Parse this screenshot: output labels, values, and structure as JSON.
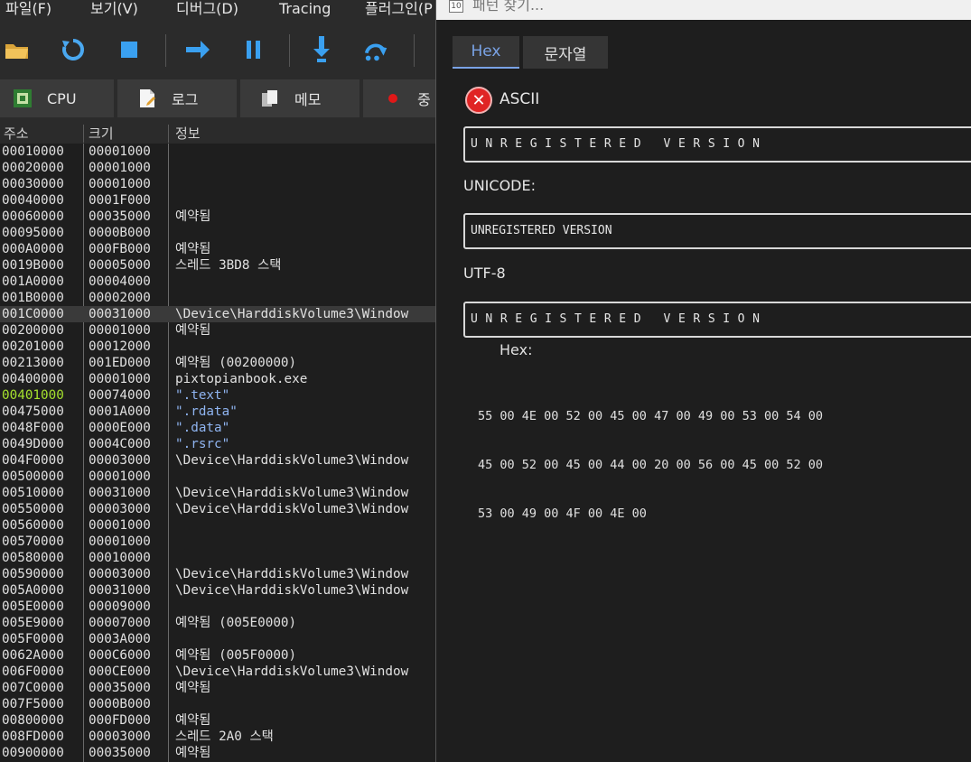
{
  "menubar": {
    "items": [
      "파일(F)",
      "보기(V)",
      "디버그(D)",
      "Tracing",
      "플러그인(P"
    ]
  },
  "toolbar": {
    "icons": [
      "open-folder-icon",
      "restart-icon",
      "stop-icon",
      "run-icon",
      "pause-icon",
      "step-into-icon",
      "step-over-icon"
    ]
  },
  "tabs": [
    {
      "label": "CPU",
      "icon": "cpu-icon"
    },
    {
      "label": "로그",
      "icon": "log-icon"
    },
    {
      "label": "메모",
      "icon": "notes-icon"
    },
    {
      "label": "중",
      "icon": "breakpoint-icon"
    }
  ],
  "memory_map": {
    "headers": [
      "주소",
      "크기",
      "정보"
    ],
    "selected_index": 10,
    "rows": [
      {
        "addr": "00010000",
        "size": "00001000",
        "info": ""
      },
      {
        "addr": "00020000",
        "size": "00001000",
        "info": ""
      },
      {
        "addr": "00030000",
        "size": "00001000",
        "info": ""
      },
      {
        "addr": "00040000",
        "size": "0001F000",
        "info": ""
      },
      {
        "addr": "00060000",
        "size": "00035000",
        "info": "예약됨"
      },
      {
        "addr": "00095000",
        "size": "0000B000",
        "info": ""
      },
      {
        "addr": "000A0000",
        "size": "000FB000",
        "info": "예약됨"
      },
      {
        "addr": "0019B000",
        "size": "00005000",
        "info": "스레드 3BD8 스택"
      },
      {
        "addr": "001A0000",
        "size": "00004000",
        "info": ""
      },
      {
        "addr": "001B0000",
        "size": "00002000",
        "info": ""
      },
      {
        "addr": "001C0000",
        "size": "00031000",
        "info": "\\Device\\HarddiskVolume3\\Window"
      },
      {
        "addr": "00200000",
        "size": "00001000",
        "info": "예약됨"
      },
      {
        "addr": "00201000",
        "size": "00012000",
        "info": ""
      },
      {
        "addr": "00213000",
        "size": "001ED000",
        "info": "예약됨 (00200000)"
      },
      {
        "addr": "00400000",
        "size": "00001000",
        "info": "pixtopianbook.exe"
      },
      {
        "addr": "00401000",
        "size": "00074000",
        "info": " \".text\"",
        "green": true,
        "section": true
      },
      {
        "addr": "00475000",
        "size": "0001A000",
        "info": " \".rdata\"",
        "section": true
      },
      {
        "addr": "0048F000",
        "size": "0000E000",
        "info": " \".data\"",
        "section": true
      },
      {
        "addr": "0049D000",
        "size": "0004C000",
        "info": " \".rsrc\"",
        "section": true
      },
      {
        "addr": "004F0000",
        "size": "00003000",
        "info": "\\Device\\HarddiskVolume3\\Window"
      },
      {
        "addr": "00500000",
        "size": "00001000",
        "info": ""
      },
      {
        "addr": "00510000",
        "size": "00031000",
        "info": "\\Device\\HarddiskVolume3\\Window"
      },
      {
        "addr": "00550000",
        "size": "00003000",
        "info": "\\Device\\HarddiskVolume3\\Window"
      },
      {
        "addr": "00560000",
        "size": "00001000",
        "info": ""
      },
      {
        "addr": "00570000",
        "size": "00001000",
        "info": ""
      },
      {
        "addr": "00580000",
        "size": "00010000",
        "info": ""
      },
      {
        "addr": "00590000",
        "size": "00003000",
        "info": "\\Device\\HarddiskVolume3\\Window"
      },
      {
        "addr": "005A0000",
        "size": "00031000",
        "info": "\\Device\\HarddiskVolume3\\Window"
      },
      {
        "addr": "005E0000",
        "size": "00009000",
        "info": ""
      },
      {
        "addr": "005E9000",
        "size": "00007000",
        "info": "예약됨 (005E0000)"
      },
      {
        "addr": "005F0000",
        "size": "0003A000",
        "info": ""
      },
      {
        "addr": "0062A000",
        "size": "000C6000",
        "info": "예약됨 (005F0000)"
      },
      {
        "addr": "006F0000",
        "size": "000CE000",
        "info": "\\Device\\HarddiskVolume3\\Window"
      },
      {
        "addr": "007C0000",
        "size": "00035000",
        "info": "예약됨"
      },
      {
        "addr": "007F5000",
        "size": "0000B000",
        "info": ""
      },
      {
        "addr": "00800000",
        "size": "000FD000",
        "info": "예약됨"
      },
      {
        "addr": "008FD000",
        "size": "00003000",
        "info": "스레드 2A0 스택"
      },
      {
        "addr": "00900000",
        "size": "00035000",
        "info": "예약됨"
      }
    ]
  },
  "dialog": {
    "title": "패턴 찾기...",
    "tabs": {
      "hex": "Hex",
      "strings": "문자열"
    },
    "ascii": {
      "label": "ASCII",
      "value": "UNREGISTERED VERSION",
      "icon": "error-icon"
    },
    "unicode": {
      "label": "UNICODE:",
      "value": "UNREGISTERED VERSION"
    },
    "utf8": {
      "label": "UTF-8",
      "value": "UNREGISTERED VERSION"
    },
    "hex": {
      "label": "Hex:",
      "lines": [
        "55 00 4E 00 52 00 45 00 47 00 49 00 53 00 54 00",
        "45 00 52 00 45 00 44 00 20 00 56 00 45 00 52 00",
        "53 00 49 00 4F 00 4E 00"
      ]
    }
  },
  "colors": {
    "accent": "#7aa3e6",
    "green_addr": "#a6e22e",
    "section_text": "#8fb4f0",
    "error_red": "#e02424"
  }
}
